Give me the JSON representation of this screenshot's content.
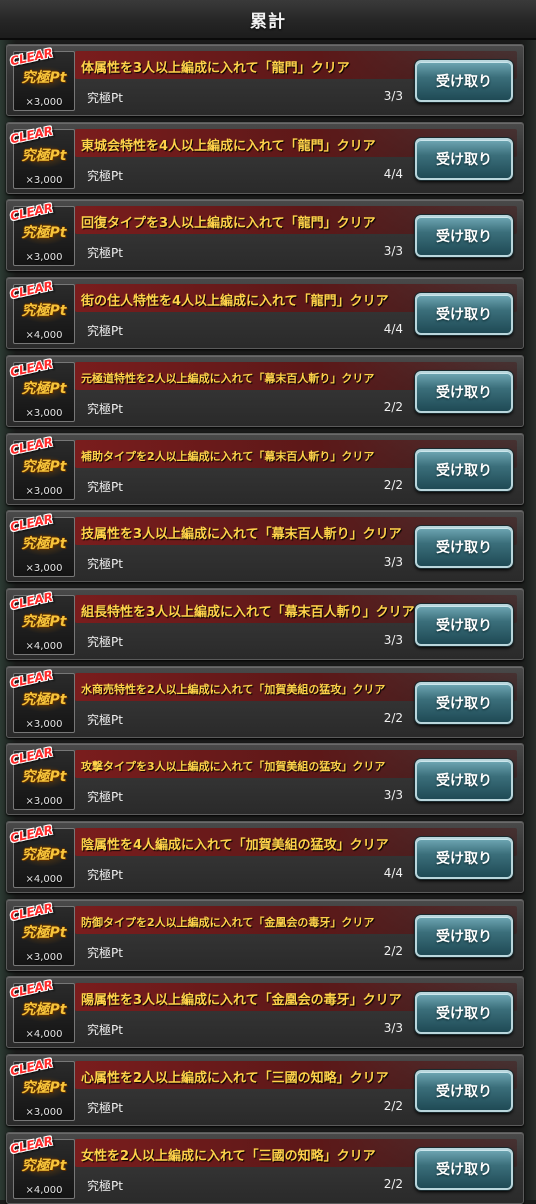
{
  "header": {
    "title": "累計"
  },
  "missions": [
    {
      "title": "体属性を3人以上編成に入れて「龍門」クリア",
      "reward": "究極Pt",
      "qty": "×3,000",
      "progress": "3/3",
      "button": "受け取り",
      "stamp": "CLEAR",
      "emblem": "究極Pt"
    },
    {
      "title": "東城会特性を4人以上編成に入れて「龍門」クリア",
      "reward": "究極Pt",
      "qty": "×3,000",
      "progress": "4/4",
      "button": "受け取り",
      "stamp": "CLEAR",
      "emblem": "究極Pt"
    },
    {
      "title": "回復タイプを3人以上編成に入れて「龍門」クリア",
      "reward": "究極Pt",
      "qty": "×3,000",
      "progress": "3/3",
      "button": "受け取り",
      "stamp": "CLEAR",
      "emblem": "究極Pt"
    },
    {
      "title": "街の住人特性を4人以上編成に入れて「龍門」クリア",
      "reward": "究極Pt",
      "qty": "×4,000",
      "progress": "4/4",
      "button": "受け取り",
      "stamp": "CLEAR",
      "emblem": "究極Pt"
    },
    {
      "title": "元極道特性を2人以上編成に入れて「幕末百人斬り」クリア",
      "reward": "究極Pt",
      "qty": "×3,000",
      "progress": "2/2",
      "button": "受け取り",
      "stamp": "CLEAR",
      "emblem": "究極Pt"
    },
    {
      "title": "補助タイプを2人以上編成に入れて「幕末百人斬り」クリア",
      "reward": "究極Pt",
      "qty": "×3,000",
      "progress": "2/2",
      "button": "受け取り",
      "stamp": "CLEAR",
      "emblem": "究極Pt"
    },
    {
      "title": "技属性を3人以上編成に入れて「幕末百人斬り」クリア",
      "reward": "究極Pt",
      "qty": "×3,000",
      "progress": "3/3",
      "button": "受け取り",
      "stamp": "CLEAR",
      "emblem": "究極Pt"
    },
    {
      "title": "組長特性を3人以上編成に入れて「幕末百人斬り」クリア",
      "reward": "究極Pt",
      "qty": "×4,000",
      "progress": "3/3",
      "button": "受け取り",
      "stamp": "CLEAR",
      "emblem": "究極Pt"
    },
    {
      "title": "水商売特性を2人以上編成に入れて「加賀美組の猛攻」クリア",
      "reward": "究極Pt",
      "qty": "×3,000",
      "progress": "2/2",
      "button": "受け取り",
      "stamp": "CLEAR",
      "emblem": "究極Pt"
    },
    {
      "title": "攻撃タイプを3人以上編成に入れて「加賀美組の猛攻」クリア",
      "reward": "究極Pt",
      "qty": "×3,000",
      "progress": "3/3",
      "button": "受け取り",
      "stamp": "CLEAR",
      "emblem": "究極Pt"
    },
    {
      "title": "陰属性を4人編成に入れて「加賀美組の猛攻」クリア",
      "reward": "究極Pt",
      "qty": "×4,000",
      "progress": "4/4",
      "button": "受け取り",
      "stamp": "CLEAR",
      "emblem": "究極Pt"
    },
    {
      "title": "防御タイプを2人以上編成に入れて「金凰会の毒牙」クリア",
      "reward": "究極Pt",
      "qty": "×3,000",
      "progress": "2/2",
      "button": "受け取り",
      "stamp": "CLEAR",
      "emblem": "究極Pt"
    },
    {
      "title": "陽属性を3人以上編成に入れて「金凰会の毒牙」クリア",
      "reward": "究極Pt",
      "qty": "×4,000",
      "progress": "3/3",
      "button": "受け取り",
      "stamp": "CLEAR",
      "emblem": "究極Pt"
    },
    {
      "title": "心属性を2人以上編成に入れて「三國の知略」クリア",
      "reward": "究極Pt",
      "qty": "×3,000",
      "progress": "2/2",
      "button": "受け取り",
      "stamp": "CLEAR",
      "emblem": "究極Pt"
    },
    {
      "title": "女性を2人以上編成に入れて「三國の知略」クリア",
      "reward": "究極Pt",
      "qty": "×4,000",
      "progress": "2/2",
      "button": "受け取り",
      "stamp": "CLEAR",
      "emblem": "究極Pt"
    }
  ]
}
